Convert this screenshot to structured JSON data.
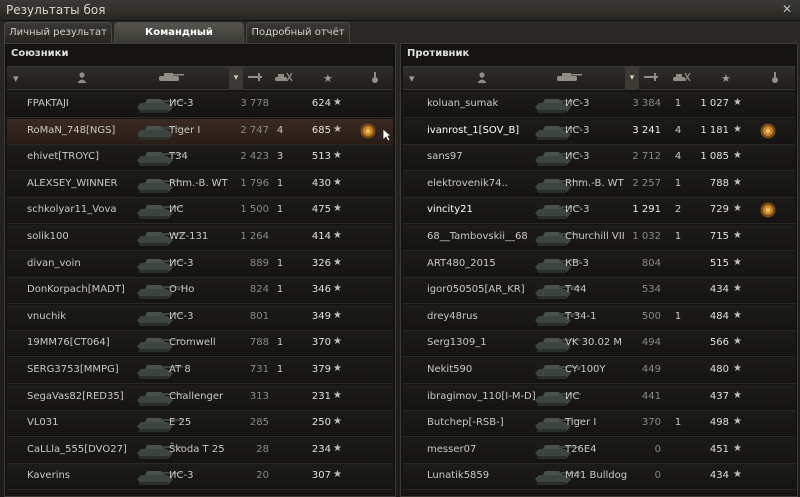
{
  "window": {
    "title": "Результаты боя"
  },
  "tabs": [
    {
      "label": "Личный результат",
      "active": false
    },
    {
      "label": "Командный результат",
      "active": true
    },
    {
      "label": "Подробный отчёт",
      "active": false
    }
  ],
  "allies": {
    "title": "Союзники",
    "rows": [
      {
        "name": "FPAKTAJI",
        "tank": "ИС-3",
        "damage": "3 778",
        "kills": "",
        "xp": "624",
        "medal": false
      },
      {
        "name": "RoMaN_748[NGS]",
        "tank": "Tiger I",
        "damage": "2 747",
        "kills": "4",
        "xp": "685",
        "medal": true
      },
      {
        "name": "ehivet[TROYC]",
        "tank": "T34",
        "damage": "2 423",
        "kills": "3",
        "xp": "513",
        "medal": false
      },
      {
        "name": "ALEXSEY_WINNER",
        "tank": "Rhm.-B. WT",
        "damage": "1 796",
        "kills": "1",
        "xp": "430",
        "medal": false
      },
      {
        "name": "schkolyar11_Vova",
        "tank": "ИС",
        "damage": "1 500",
        "kills": "1",
        "xp": "475",
        "medal": false
      },
      {
        "name": "solik100",
        "tank": "WZ-131",
        "damage": "1 264",
        "kills": "",
        "xp": "414",
        "medal": false
      },
      {
        "name": "divan_voin",
        "tank": "ИС-3",
        "damage": "889",
        "kills": "1",
        "xp": "326",
        "medal": false
      },
      {
        "name": "DonKorpach[MADT]",
        "tank": "O-Ho",
        "damage": "824",
        "kills": "1",
        "xp": "346",
        "medal": false
      },
      {
        "name": "vnuchik",
        "tank": "ИС-3",
        "damage": "801",
        "kills": "",
        "xp": "349",
        "medal": false
      },
      {
        "name": "19MM76[CT064]",
        "tank": "Cromwell",
        "damage": "788",
        "kills": "1",
        "xp": "370",
        "medal": false
      },
      {
        "name": "SERG3753[MMPG]",
        "tank": "AT 8",
        "damage": "731",
        "kills": "1",
        "xp": "379",
        "medal": false
      },
      {
        "name": "SegaVas82[RED35]",
        "tank": "Challenger",
        "damage": "313",
        "kills": "",
        "xp": "231",
        "medal": false
      },
      {
        "name": "VL031",
        "tank": "E 25",
        "damage": "285",
        "kills": "",
        "xp": "250",
        "medal": false
      },
      {
        "name": "CaLLla_555[DVO27]",
        "tank": "Škoda T 25",
        "damage": "28",
        "kills": "",
        "xp": "234",
        "medal": false
      },
      {
        "name": "Kaverins",
        "tank": "ИС-3",
        "damage": "20",
        "kills": "",
        "xp": "307",
        "medal": false
      }
    ]
  },
  "enemies": {
    "title": "Противник",
    "rows": [
      {
        "name": "koluan_sumak",
        "tank": "ИС-3",
        "damage": "3 384",
        "kills": "1",
        "xp": "1 027",
        "medal": false
      },
      {
        "name": "ivanrost_1[SOV_B]",
        "tank": "ИС-3",
        "damage": "3 241",
        "kills": "4",
        "xp": "1 181",
        "medal": true
      },
      {
        "name": "sans97",
        "tank": "ИС-3",
        "damage": "2 712",
        "kills": "4",
        "xp": "1 085",
        "medal": false
      },
      {
        "name": "elektrovenik74..",
        "tank": "Rhm.-B. WT",
        "damage": "2 257",
        "kills": "1",
        "xp": "788",
        "medal": false
      },
      {
        "name": "vincity21",
        "tank": "ИС-3",
        "damage": "1 291",
        "kills": "2",
        "xp": "729",
        "medal": true
      },
      {
        "name": "68__Tambovskii__68",
        "tank": "Churchill VII",
        "damage": "1 032",
        "kills": "1",
        "xp": "715",
        "medal": false
      },
      {
        "name": "ART480_2015",
        "tank": "КВ-3",
        "damage": "804",
        "kills": "",
        "xp": "515",
        "medal": false
      },
      {
        "name": "igor050505[AR_KR]",
        "tank": "T-44",
        "damage": "534",
        "kills": "",
        "xp": "434",
        "medal": false
      },
      {
        "name": "drey48rus",
        "tank": "T-34-1",
        "damage": "500",
        "kills": "1",
        "xp": "484",
        "medal": false
      },
      {
        "name": "Serg1309_1",
        "tank": "VK 30.02 M",
        "damage": "494",
        "kills": "",
        "xp": "566",
        "medal": false
      },
      {
        "name": "Nekit590",
        "tank": "CY-100Y",
        "damage": "449",
        "kills": "",
        "xp": "480",
        "medal": false
      },
      {
        "name": "ibragimov_110[I-M-D]",
        "tank": "ИС",
        "damage": "441",
        "kills": "",
        "xp": "437",
        "medal": false
      },
      {
        "name": "Butchep[-RSB-]",
        "tank": "Tiger I",
        "damage": "370",
        "kills": "1",
        "xp": "498",
        "medal": false
      },
      {
        "name": "messer07",
        "tank": "T26E4",
        "damage": "0",
        "kills": "",
        "xp": "451",
        "medal": false
      },
      {
        "name": "Lunatik5859",
        "tank": "M41 Bulldog",
        "damage": "0",
        "kills": "",
        "xp": "434",
        "medal": false
      }
    ]
  },
  "header_icons": [
    "platoon-icon",
    "player-icon",
    "tank-type-icon",
    "sort-icon",
    "damage-icon",
    "kills-icon",
    "xp-star-icon",
    "medal-icon"
  ],
  "colors": {
    "accent": "#d8d0a0",
    "highlight_row": "#3a2a22",
    "medal": "#c88a2a"
  }
}
